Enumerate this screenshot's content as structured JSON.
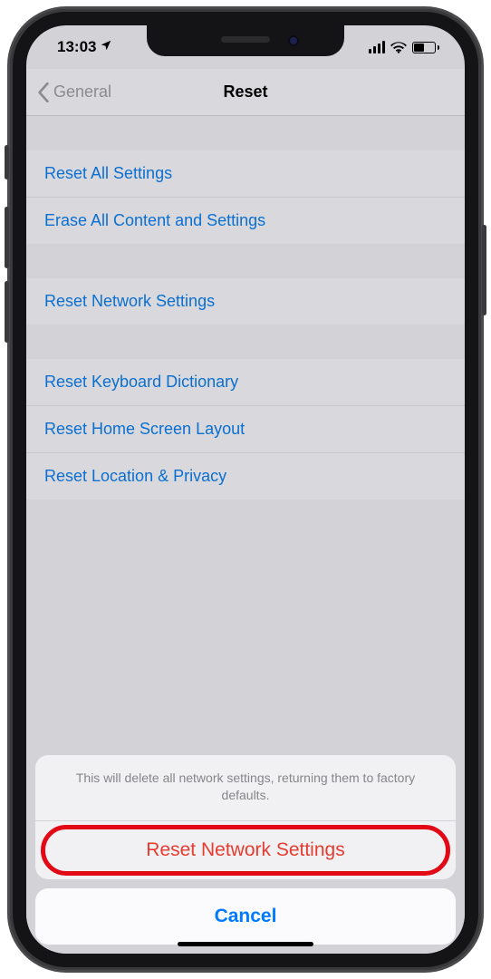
{
  "statusbar": {
    "time": "13:03",
    "location_icon": "location-arrow-icon",
    "signal_icon": "signal-icon",
    "wifi_icon": "wifi-icon",
    "battery_icon": "battery-icon"
  },
  "navbar": {
    "back_label": "General",
    "back_icon": "chevron-left-icon",
    "title": "Reset"
  },
  "groups": [
    {
      "cells": [
        {
          "label": "Reset All Settings"
        },
        {
          "label": "Erase All Content and Settings"
        }
      ]
    },
    {
      "cells": [
        {
          "label": "Reset Network Settings"
        }
      ]
    },
    {
      "cells": [
        {
          "label": "Reset Keyboard Dictionary"
        },
        {
          "label": "Reset Home Screen Layout"
        },
        {
          "label": "Reset Location & Privacy"
        }
      ]
    }
  ],
  "action_sheet": {
    "message": "This will delete all network settings, returning them to factory defaults.",
    "destructive_label": "Reset Network Settings",
    "cancel_label": "Cancel"
  },
  "colors": {
    "link": "#0b6fd1",
    "destructive": "#e63c30",
    "primary": "#007aff",
    "annotation": "#e30815"
  }
}
